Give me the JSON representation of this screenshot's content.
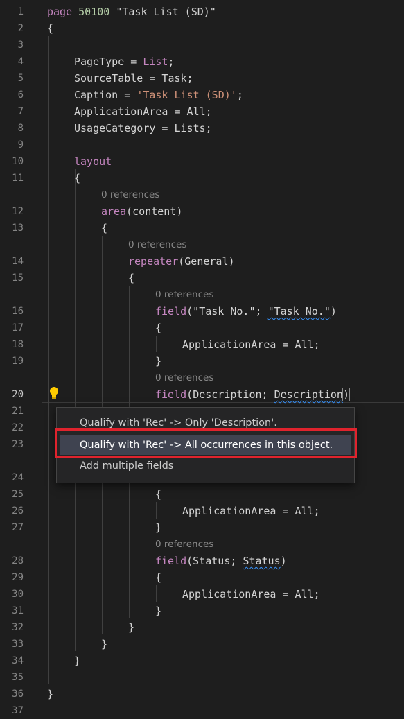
{
  "editor": {
    "lines": [
      {
        "n": "1",
        "code": [
          {
            "t": "page",
            "c": "kw"
          },
          {
            "t": " "
          },
          {
            "t": "50100",
            "c": "num"
          },
          {
            "t": " \"Task List (SD)\""
          }
        ]
      },
      {
        "n": "2",
        "code": [
          {
            "t": "{"
          }
        ]
      },
      {
        "n": "3",
        "code": []
      },
      {
        "n": "4",
        "code": [
          {
            "t": "PageType = "
          },
          {
            "t": "List",
            "c": "kw"
          },
          {
            "t": ";"
          }
        ]
      },
      {
        "n": "5",
        "code": [
          {
            "t": "SourceTable = Task;"
          }
        ]
      },
      {
        "n": "6",
        "code": [
          {
            "t": "Caption = "
          },
          {
            "t": "'Task List (SD)'",
            "c": "str"
          },
          {
            "t": ";"
          }
        ]
      },
      {
        "n": "7",
        "code": [
          {
            "t": "ApplicationArea = All;"
          }
        ]
      },
      {
        "n": "8",
        "code": [
          {
            "t": "UsageCategory = Lists;"
          }
        ]
      },
      {
        "n": "9",
        "code": []
      },
      {
        "n": "10",
        "code": [
          {
            "t": "layout",
            "c": "kw"
          }
        ]
      },
      {
        "n": "11",
        "code": [
          {
            "t": "{"
          }
        ]
      },
      {
        "n": "12",
        "refs": "0 references",
        "code": [
          {
            "t": "area",
            "c": "kw"
          },
          {
            "t": "(content)"
          }
        ]
      },
      {
        "n": "13",
        "code": [
          {
            "t": "{"
          }
        ]
      },
      {
        "n": "14",
        "refs": "0 references",
        "code": [
          {
            "t": "repeater",
            "c": "kw"
          },
          {
            "t": "(General)"
          }
        ]
      },
      {
        "n": "15",
        "code": [
          {
            "t": "{"
          }
        ]
      },
      {
        "n": "16",
        "refs": "0 references",
        "code": [
          {
            "t": "field",
            "c": "kw"
          },
          {
            "t": "(\"Task No.\"; "
          },
          {
            "t": "\"Task No.\"",
            "c": "sq"
          },
          {
            "t": ")"
          }
        ]
      },
      {
        "n": "17",
        "code": [
          {
            "t": "{"
          }
        ]
      },
      {
        "n": "18",
        "code": [
          {
            "t": "ApplicationArea = All;"
          }
        ]
      },
      {
        "n": "19",
        "code": [
          {
            "t": "}"
          }
        ]
      },
      {
        "n": "20",
        "refs": "0 references",
        "code": [
          {
            "t": "field",
            "c": "kw"
          },
          {
            "t": "(",
            "c": "bracket-box"
          },
          {
            "t": "Description; "
          },
          {
            "t": "Description",
            "c": "sq"
          },
          {
            "t": ")",
            "c": "bracket-box"
          }
        ]
      },
      {
        "n": "21",
        "code": []
      },
      {
        "n": "22",
        "code": []
      },
      {
        "n": "23",
        "code": []
      },
      {
        "n": "24",
        "code": []
      },
      {
        "n": "25",
        "code": [
          {
            "t": "{"
          }
        ]
      },
      {
        "n": "26",
        "code": [
          {
            "t": "ApplicationArea = All;"
          }
        ]
      },
      {
        "n": "27",
        "code": [
          {
            "t": "}"
          }
        ]
      },
      {
        "n": "28",
        "refs": "0 references",
        "code": [
          {
            "t": "field",
            "c": "kw"
          },
          {
            "t": "(Status; "
          },
          {
            "t": "Status",
            "c": "sq"
          },
          {
            "t": ")"
          }
        ]
      },
      {
        "n": "29",
        "code": [
          {
            "t": "{"
          }
        ]
      },
      {
        "n": "30",
        "code": [
          {
            "t": "ApplicationArea = All;"
          }
        ]
      },
      {
        "n": "31",
        "code": [
          {
            "t": "}"
          }
        ]
      },
      {
        "n": "32",
        "code": [
          {
            "t": "}"
          }
        ]
      },
      {
        "n": "33",
        "code": [
          {
            "t": "}"
          }
        ]
      },
      {
        "n": "34",
        "code": [
          {
            "t": "}"
          }
        ]
      },
      {
        "n": "35",
        "code": []
      },
      {
        "n": "36",
        "code": [
          {
            "t": "}"
          }
        ]
      },
      {
        "n": "37",
        "code": []
      }
    ]
  },
  "quick_fix_menu": {
    "items": [
      {
        "label": "Qualify with 'Rec' -> Only 'Description'.",
        "selected": false
      },
      {
        "label": "Qualify with 'Rec' -> All occurrences in this object.",
        "selected": true
      },
      {
        "label": "Add multiple fields",
        "selected": false
      }
    ]
  },
  "colors": {
    "background": "#1e1e1e",
    "keyword": "#c586c0",
    "string": "#ce9178",
    "number": "#b5cea8",
    "highlight_box": "#e0232d",
    "lightbulb": "#ffcc00"
  },
  "icons": {
    "lightbulb": "lightbulb-icon"
  }
}
